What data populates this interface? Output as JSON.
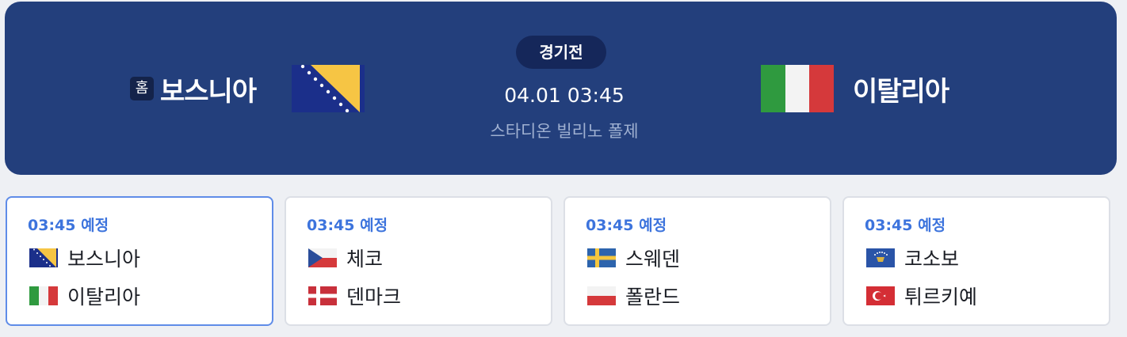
{
  "match": {
    "home_badge": "홈",
    "home_team": "보스니아",
    "away_team": "이탈리아",
    "status": "경기전",
    "datetime": "04.01 03:45",
    "venue": "스타디온 빌리노 폴제"
  },
  "games": [
    {
      "time": "03:45 예정",
      "home": "보스니아",
      "away": "이탈리아",
      "home_flag": "bosnia-flag-icon",
      "away_flag": "italy-flag-icon"
    },
    {
      "time": "03:45 예정",
      "home": "체코",
      "away": "덴마크",
      "home_flag": "czech-flag-icon",
      "away_flag": "denmark-flag-icon"
    },
    {
      "time": "03:45 예정",
      "home": "스웨덴",
      "away": "폴란드",
      "home_flag": "sweden-flag-icon",
      "away_flag": "poland-flag-icon"
    },
    {
      "time": "03:45 예정",
      "home": "코소보",
      "away": "튀르키예",
      "home_flag": "kosovo-flag-icon",
      "away_flag": "turkey-flag-icon"
    }
  ],
  "colors": {
    "hero_bg": "#233f7c",
    "pill_bg": "#15275a",
    "accent_blue": "#3d74dd",
    "selected_border": "#5f8ce8"
  }
}
